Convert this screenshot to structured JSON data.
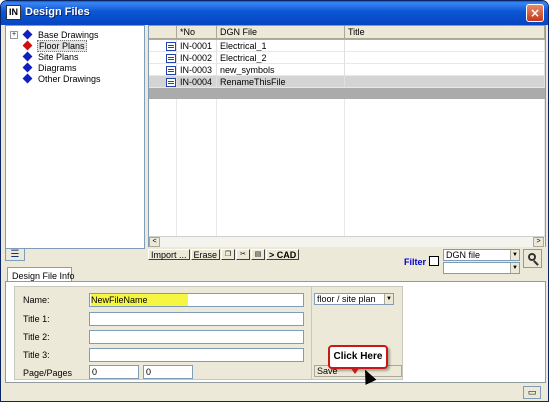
{
  "window": {
    "title": "Design Files",
    "icon_text": "IN",
    "close_glyph": "×"
  },
  "tree": {
    "items": [
      {
        "label": "Base Drawings",
        "expandable": true,
        "color": "#1020c0",
        "selected": false
      },
      {
        "label": "Floor Plans",
        "expandable": false,
        "color": "#d01010",
        "selected": true
      },
      {
        "label": "Site Plans",
        "expandable": false,
        "color": "#1020c0",
        "selected": false
      },
      {
        "label": "Diagrams",
        "expandable": false,
        "color": "#1020c0",
        "selected": false
      },
      {
        "label": "Other Drawings",
        "expandable": false,
        "color": "#1020c0",
        "selected": false
      }
    ],
    "expand_glyph": "+"
  },
  "grid": {
    "columns": [
      "",
      "*No",
      "DGN File",
      "Title"
    ],
    "rows": [
      {
        "no": "IN-0001",
        "file": "Electrical_1",
        "title": "",
        "selected": false
      },
      {
        "no": "IN-0002",
        "file": "Electrical_2",
        "title": "",
        "selected": false
      },
      {
        "no": "IN-0003",
        "file": "new_symbols",
        "title": "",
        "selected": false
      },
      {
        "no": "IN-0004",
        "file": "RenameThisFile",
        "title": "",
        "selected": true
      }
    ],
    "scroll_left": "<",
    "scroll_right": ">"
  },
  "toolbar": {
    "import_label": "Import ...",
    "erase_label": "Erase",
    "cad_label": "> CAD",
    "icons": [
      "copy-icon",
      "cut-icon",
      "paste-icon"
    ]
  },
  "filter": {
    "label": "Filter",
    "checked": false,
    "type_value": "DGN file",
    "second_value": "",
    "dropdown_glyph": "▼"
  },
  "tab": {
    "label": "Design File Info"
  },
  "form": {
    "name_label": "Name:",
    "name_value": "NewFileName",
    "title1_label": "Title 1:",
    "title1_value": "",
    "title2_label": "Title 2:",
    "title2_value": "",
    "title3_label": "Title 3:",
    "title3_value": "",
    "pages_label": "Page/Pages",
    "page_value": "0",
    "pages_value": "0"
  },
  "side": {
    "category_value": "floor / site plan",
    "save_label": "Save",
    "callout_text": "Click Here"
  },
  "colors": {
    "highlight": "#f5f542",
    "callout_border": "#c81818",
    "filter_text": "#0000cc"
  }
}
